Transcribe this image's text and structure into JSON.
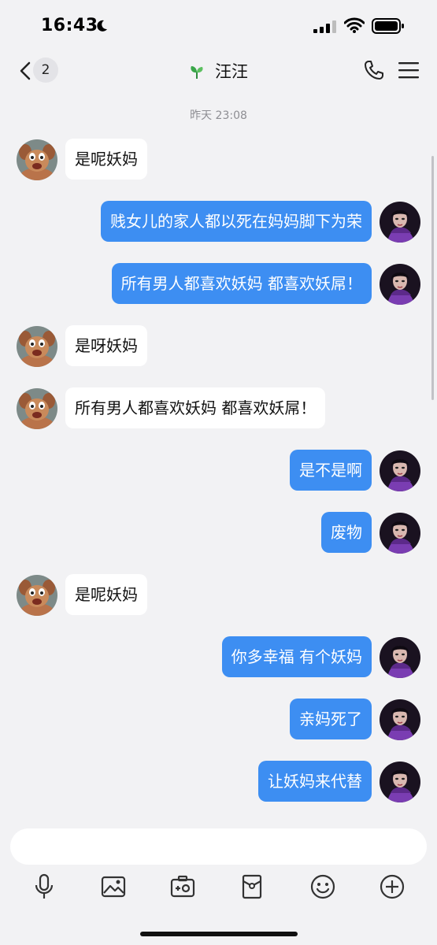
{
  "status_bar": {
    "time": "16:43"
  },
  "header": {
    "badge_count": "2",
    "title": "汪汪"
  },
  "chat": {
    "timestamp": "昨天 23:08",
    "messages": [
      {
        "side": "left",
        "text": "是呢妖妈"
      },
      {
        "side": "right",
        "text": "贱女儿的家人都以死在妈妈脚下为荣"
      },
      {
        "side": "right",
        "text": "所有男人都喜欢妖妈 都喜欢妖屌！"
      },
      {
        "side": "left",
        "text": "是呀妖妈"
      },
      {
        "side": "left",
        "text": "所有男人都喜欢妖妈 都喜欢妖屌！"
      },
      {
        "side": "right",
        "text": "是不是啊"
      },
      {
        "side": "right",
        "text": "废物"
      },
      {
        "side": "left",
        "text": "是呢妖妈"
      },
      {
        "side": "right",
        "text": "你多幸福 有个妖妈"
      },
      {
        "side": "right",
        "text": "亲妈死了"
      },
      {
        "side": "right",
        "text": "让妖妈来代替"
      }
    ]
  },
  "composer": {
    "input_value": "",
    "tools": [
      "microphone-icon",
      "image-icon",
      "camera-icon",
      "red-packet-icon",
      "emoji-icon",
      "plus-icon"
    ]
  },
  "colors": {
    "outgoing_bubble": "#3d8ef2",
    "incoming_bubble": "#ffffff",
    "background": "#f2f2f4"
  }
}
